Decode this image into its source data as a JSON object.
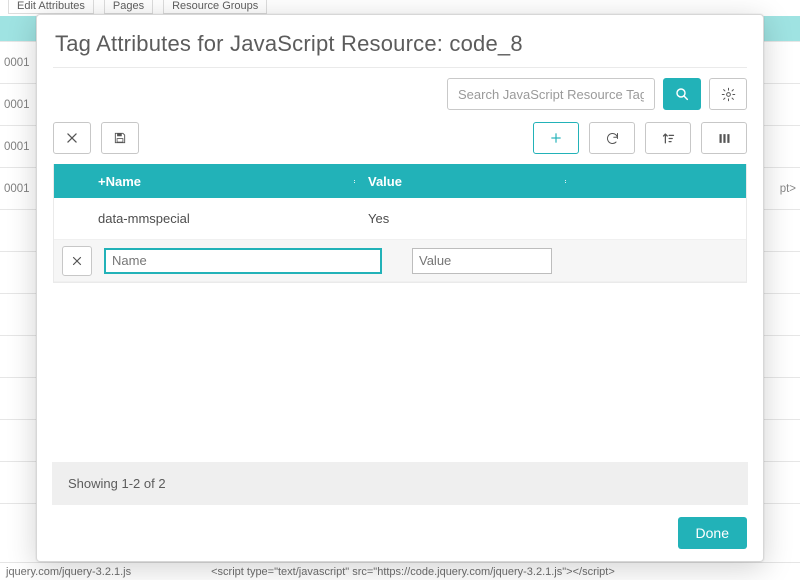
{
  "background": {
    "tabs": [
      "Edit Attributes",
      "Pages",
      "Resource Groups"
    ],
    "row_label": "0001",
    "row_trail": "pt>",
    "footer_left": "jquery.com/jquery-3.2.1.js",
    "footer_mid": "<script type=\"text/javascript\" src=\"https://code.jquery.com/jquery-3.2.1.js\"></script>"
  },
  "modal": {
    "title": "Tag Attributes for JavaScript Resource: code_8",
    "search_placeholder": "Search JavaScript Resource Tag At",
    "headers": {
      "name": "+Name",
      "value": "Value"
    },
    "rows": [
      {
        "name": "data-mmspecial",
        "value": "Yes"
      }
    ],
    "edit_row": {
      "name_placeholder": "Name",
      "value_placeholder": "Value"
    },
    "status": "Showing 1-2 of 2",
    "done": "Done"
  }
}
